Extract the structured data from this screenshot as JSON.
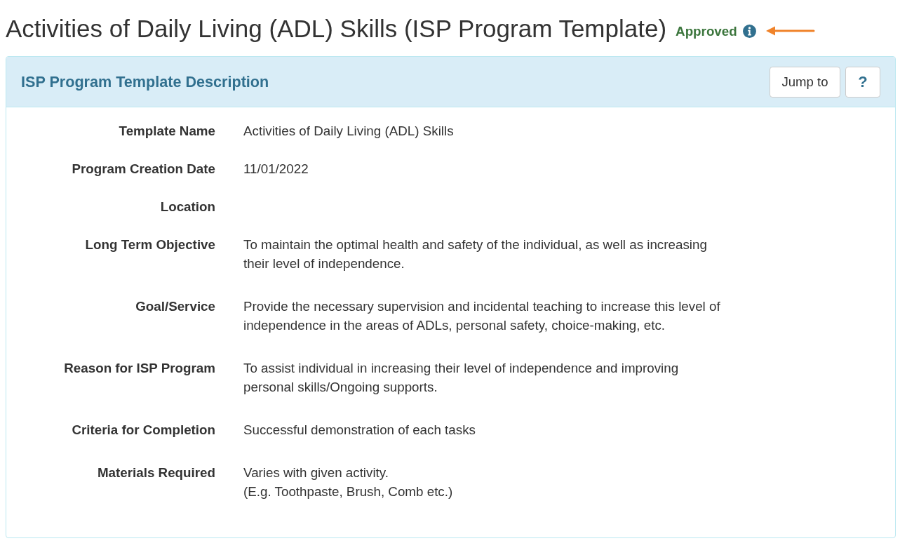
{
  "page": {
    "title": "Activities of Daily Living (ADL) Skills (ISP Program Template)",
    "status": "Approved"
  },
  "panel": {
    "heading": "ISP Program Template Description",
    "buttons": [
      {
        "kind": "text",
        "label": "Jump to"
      },
      {
        "kind": "help",
        "label": "?"
      }
    ],
    "fields": [
      {
        "kind": "line",
        "label": "Template Name",
        "value": "Activities of Daily Living (ADL) Skills"
      },
      {
        "kind": "line",
        "label": "Program Creation Date",
        "value": "11/01/2022"
      },
      {
        "kind": "line",
        "label": "Location"
      },
      {
        "kind": "paragraph",
        "label": "Long Term Objective",
        "value": "To maintain the optimal health and safety of the individual, as well as increasing their level of independence."
      },
      {
        "kind": "paragraph",
        "label": "Goal/Service",
        "value": "Provide the necessary supervision and incidental teaching to increase this level of independence in the areas of ADLs, personal safety, choice-making, etc."
      },
      {
        "kind": "paragraph",
        "label": "Reason for ISP Program",
        "value": "To assist individual in increasing their level of independence and improving personal skills/Ongoing supports."
      },
      {
        "kind": "paragraph",
        "label": "Criteria for Completion",
        "value": "Successful demonstration of each tasks"
      },
      {
        "kind": "paragraph",
        "label": "Materials Required",
        "value": "Varies with given activity.\n(E.g. Toothpaste, Brush, Comb etc.)"
      }
    ]
  }
}
